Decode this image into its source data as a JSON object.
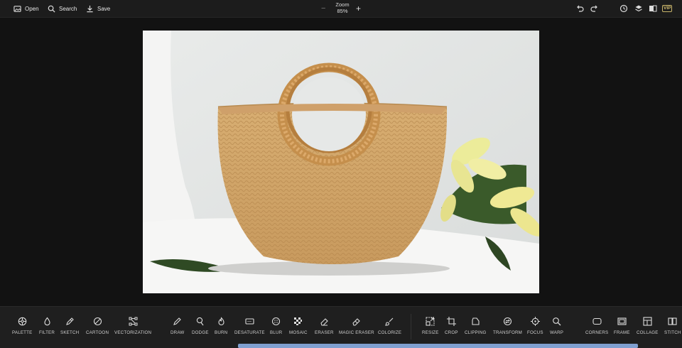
{
  "toolbar": {
    "open_label": "Open",
    "search_label": "Search",
    "save_label": "Save",
    "zoom_title": "Zoom",
    "zoom_value": "85%",
    "zoom_minus": "−",
    "zoom_plus": "+",
    "vip_label": "VIP",
    "icons": [
      "open-icon",
      "search-icon",
      "save-icon",
      "undo-icon",
      "redo-icon",
      "history-icon",
      "layers-icon",
      "compare-icon",
      "vip-icon"
    ]
  },
  "tools": {
    "palette": "PALETTE",
    "filter": "FILTER",
    "sketch": "SKETCH",
    "cartoon": "CARTOON",
    "vectorization": "VECTORIZATION",
    "draw": "DRAW",
    "dodge": "DODGE",
    "burn": "BURN",
    "desaturate": "DESATURATE",
    "blur": "BLUR",
    "mosaic": "MOSAIC",
    "eraser": "ERASER",
    "magic_eraser": "MAGIC ERASER",
    "colorize": "COLORIZE",
    "resize": "RESIZE",
    "crop": "CROP",
    "clipping": "CLIPPING",
    "transform": "TRANSFORM",
    "focus": "FOCUS",
    "warp": "WARP",
    "corners": "CORNERS",
    "frame": "FRAME",
    "collage": "COLLAGE",
    "stitch": "STITCH"
  },
  "colors": {
    "accent": "#7f9fcf",
    "bar": "#1f1f1f",
    "canvas": "#121212"
  }
}
